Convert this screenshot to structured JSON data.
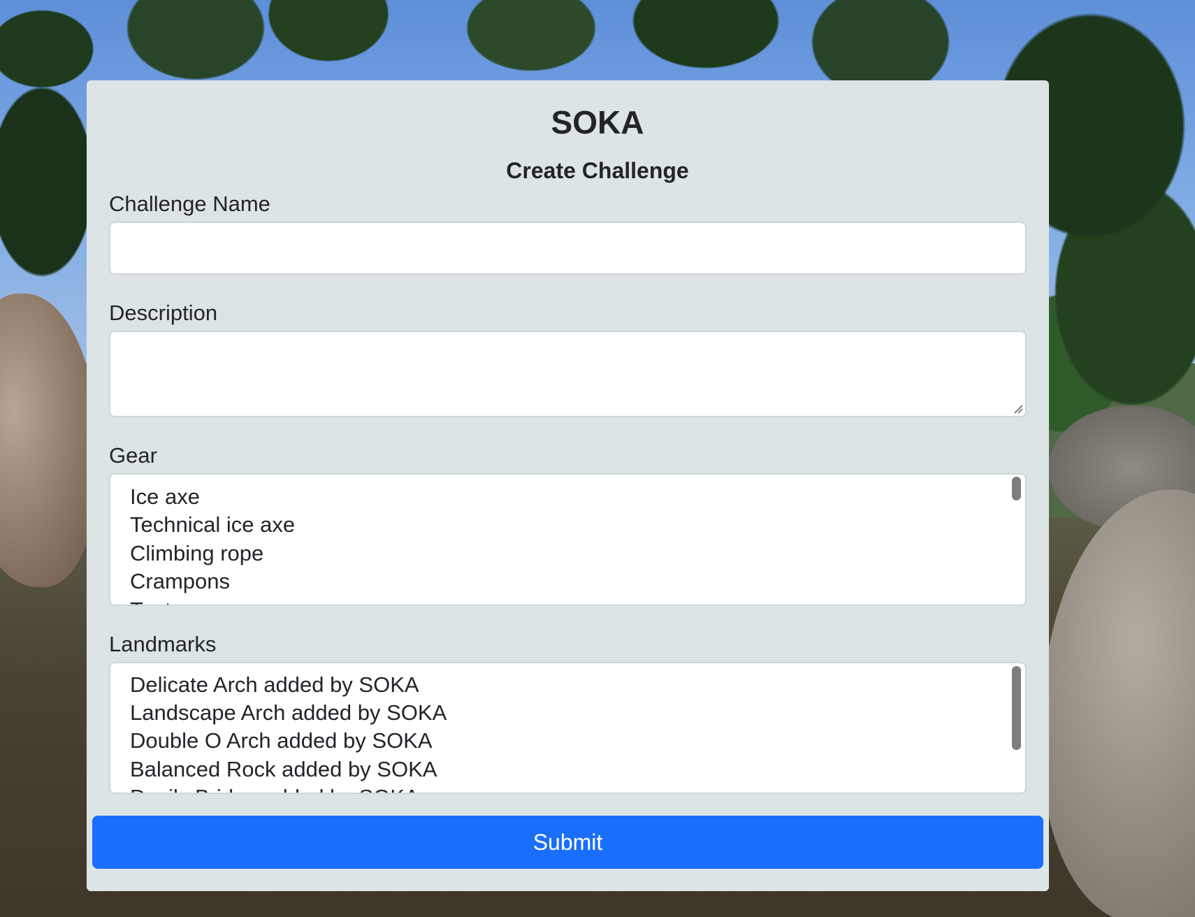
{
  "header": {
    "brand": "SOKA",
    "subtitle": "Create Challenge"
  },
  "form": {
    "challenge_name": {
      "label": "Challenge Name",
      "value": ""
    },
    "description": {
      "label": "Description",
      "value": ""
    },
    "gear": {
      "label": "Gear",
      "options": [
        "Ice axe",
        "Technical ice axe",
        "Climbing rope",
        "Crampons",
        "Tent"
      ]
    },
    "landmarks": {
      "label": "Landmarks",
      "options": [
        "Delicate Arch added by SOKA",
        "Landscape Arch added by SOKA",
        "Double O Arch added by SOKA",
        "Balanced Rock added by SOKA",
        "Devils Bridge added by SOKA"
      ]
    },
    "submit_label": "Submit"
  },
  "colors": {
    "card_background": "#dde4e6",
    "submit_background": "#1a6efc",
    "text": "#212529",
    "field_border": "#ced4da"
  },
  "icons": {
    "textarea_resize": "resize-grip-icon"
  }
}
